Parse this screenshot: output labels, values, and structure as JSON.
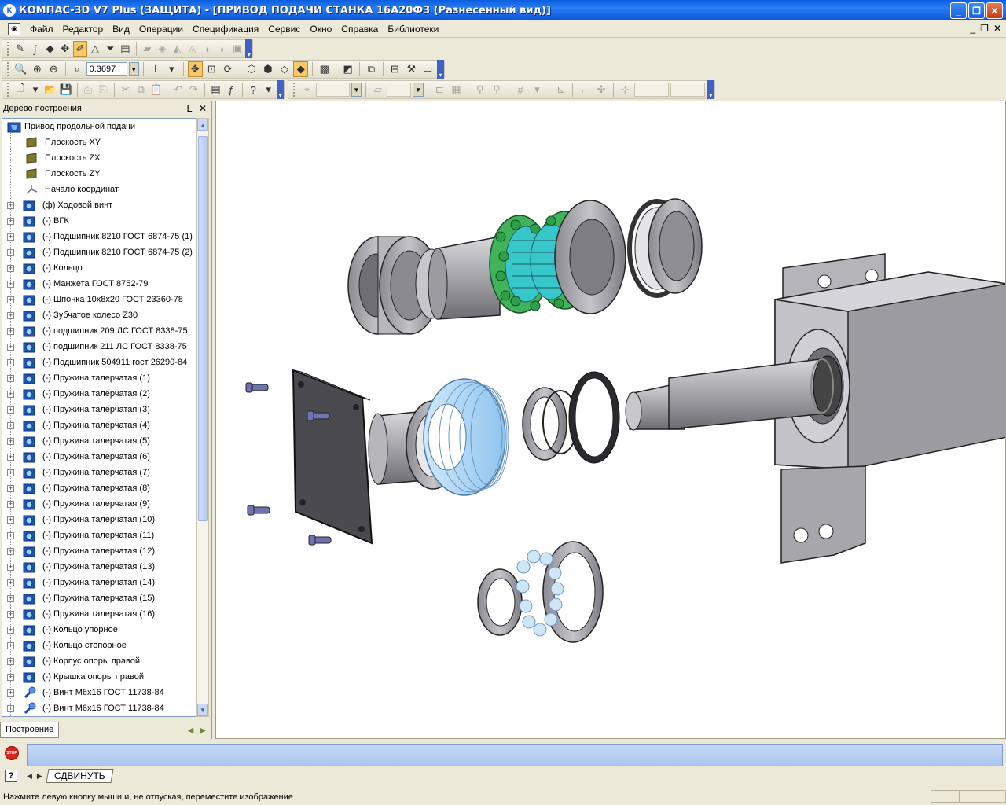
{
  "window": {
    "title": "КОМПАС-3D V7 Plus (ЗАЩИТА) - [ПРИВОД ПОДАЧИ СТАНКА 16А20Ф3 (Разнесенный вид)]",
    "icon": "kompas-logo-icon",
    "btn_minimize": "_",
    "btn_restore": "❐",
    "btn_close": "✕"
  },
  "menu": {
    "items": [
      {
        "label": "Файл"
      },
      {
        "label": "Редактор"
      },
      {
        "label": "Вид"
      },
      {
        "label": "Операции"
      },
      {
        "label": "Спецификация"
      },
      {
        "label": "Сервис"
      },
      {
        "label": "Окно"
      },
      {
        "label": "Справка"
      },
      {
        "label": "Библиотеки"
      }
    ],
    "mdi_minimize": "_",
    "mdi_restore": "❐",
    "mdi_close": "✕"
  },
  "toolbar_view": {
    "zoom_value": "0.3697"
  },
  "tree": {
    "title": "Дерево построения",
    "pin": "ⴹ",
    "close": "✕",
    "root": "Привод продольной подачи",
    "planes": [
      {
        "label": "Плоскость XY"
      },
      {
        "label": "Плоскость ZX"
      },
      {
        "label": "Плоскость ZY"
      },
      {
        "label": "Начало координат"
      }
    ],
    "parts": [
      {
        "label": "(ф) Ходовой винт"
      },
      {
        "label": "(-) ВГК"
      },
      {
        "label": "(-) Подшипник 8210 ГОСТ 6874-75 (1)"
      },
      {
        "label": "(-) Подшипник 8210 ГОСТ 6874-75 (2)"
      },
      {
        "label": "(-) Кольцо"
      },
      {
        "label": "(-) Манжета ГОСТ 8752-79"
      },
      {
        "label": "(-) Шпонка 10х8х20 ГОСТ 23360-78"
      },
      {
        "label": "(-) Зубчатое колесо Z30"
      },
      {
        "label": "(-) подшипник 209 ЛС ГОСТ 8338-75"
      },
      {
        "label": "(-) подшипник 211 ЛС ГОСТ 8338-75"
      },
      {
        "label": "(-) Подшипник 504911 гост 26290-84"
      },
      {
        "label": "(-) Пружина талерчатая (1)"
      },
      {
        "label": "(-) Пружина талерчатая (2)"
      },
      {
        "label": "(-) Пружина талерчатая (3)"
      },
      {
        "label": "(-) Пружина талерчатая (4)"
      },
      {
        "label": "(-) Пружина талерчатая (5)"
      },
      {
        "label": "(-) Пружина талерчатая (6)"
      },
      {
        "label": "(-) Пружина талерчатая (7)"
      },
      {
        "label": "(-) Пружина талерчатая (8)"
      },
      {
        "label": "(-) Пружина талерчатая (9)"
      },
      {
        "label": "(-) Пружина талерчатая (10)"
      },
      {
        "label": "(-) Пружина талерчатая (11)"
      },
      {
        "label": "(-) Пружина талерчатая (12)"
      },
      {
        "label": "(-) Пружина талерчатая (13)"
      },
      {
        "label": "(-) Пружина талерчатая (14)"
      },
      {
        "label": "(-) Пружина талерчатая (15)"
      },
      {
        "label": "(-) Пружина талерчатая (16)"
      },
      {
        "label": "(-) Кольцо упорное"
      },
      {
        "label": "(-) Кольцо стопорное"
      },
      {
        "label": "(-) Корпус опоры правой"
      },
      {
        "label": "(-) Крышка опоры правой"
      },
      {
        "label": "(-) Винт М6х16 ГОСТ 11738-84"
      },
      {
        "label": "(-) Винт М6х16 ГОСТ 11738-84"
      }
    ],
    "tab_label": "Построение"
  },
  "command": {
    "tab_label": "СДВИНУТЬ",
    "stop_text": "STOP",
    "help_text": "?"
  },
  "status": {
    "text": "Нажмите левую кнопку мыши и, не отпуская, переместите изображение"
  },
  "colors": {
    "titlebar": "#0a52d6",
    "part_gray": "#a7a7ab",
    "part_green": "#3fb45a",
    "part_cyan": "#37c6c9",
    "part_light_blue": "#a9d6f5"
  }
}
